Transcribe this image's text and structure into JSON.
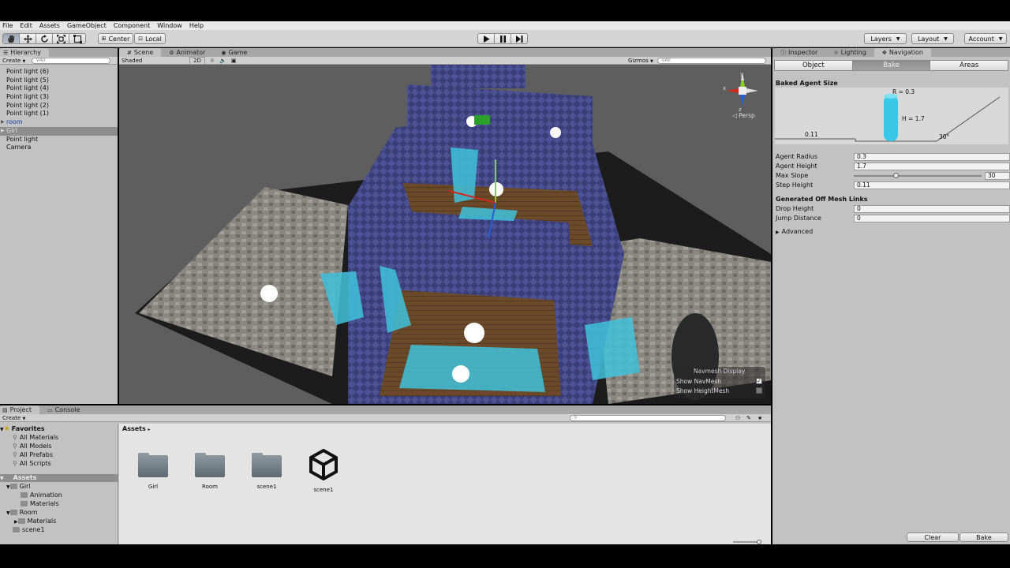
{
  "menubar": {
    "items": [
      "File",
      "Edit",
      "Assets",
      "GameObject",
      "Component",
      "Window",
      "Help"
    ]
  },
  "toolbar": {
    "tools": [
      "hand-icon",
      "move-icon",
      "rotate-icon",
      "scale-icon",
      "rect-icon"
    ],
    "pivot_label": "Center",
    "space_label": "Local",
    "layers_label": "Layers",
    "layout_label": "Layout",
    "account_label": "Account"
  },
  "hierarchy": {
    "tab_label": "Hierarchy",
    "create_label": "Create",
    "search_placeholder": "All",
    "items": [
      {
        "label": "Point light (6)"
      },
      {
        "label": "Point light (5)"
      },
      {
        "label": "Point light (4)"
      },
      {
        "label": "Point light (3)"
      },
      {
        "label": "Point light (2)"
      },
      {
        "label": "Point light (1)"
      },
      {
        "label": "room"
      },
      {
        "label": "Girl"
      },
      {
        "label": "Point light"
      },
      {
        "label": "Camera"
      }
    ]
  },
  "scene": {
    "tabs": [
      "Scene",
      "Animator",
      "Game"
    ],
    "shading_mode": "Shaded",
    "mode_2d_label": "2D",
    "gizmos_label": "Gizmos",
    "search_placeholder": "All",
    "persp_label": "Persp",
    "gizmo_axes": {
      "y": "y",
      "x": "x",
      "z": "z"
    },
    "navmesh_display": {
      "title": "Navmesh Display",
      "show_navmesh_label": "Show NavMesh",
      "show_navmesh_checked": true,
      "show_heightmesh_label": "Show HeightMesh",
      "show_heightmesh_checked": false
    }
  },
  "inspector": {
    "tabs": [
      "Inspector",
      "Lighting",
      "Navigation"
    ],
    "segments": [
      "Object",
      "Bake",
      "Areas"
    ],
    "active_segment": "Bake",
    "baked_agent_size_title": "Baked Agent Size",
    "diagram": {
      "radius_text": "R = 0.3",
      "height_text": "H = 1.7",
      "step_text": "0.11",
      "slope_text": "30°"
    },
    "agent_radius_label": "Agent Radius",
    "agent_radius": "0.3",
    "agent_height_label": "Agent Height",
    "agent_height": "1.7",
    "max_slope_label": "Max Slope",
    "max_slope": "30",
    "max_slope_fraction": 0.33,
    "step_height_label": "Step Height",
    "step_height": "0.11",
    "off_mesh_title": "Generated Off Mesh Links",
    "drop_height_label": "Drop Height",
    "drop_height": "0",
    "jump_distance_label": "Jump Distance",
    "jump_distance": "0",
    "advanced_label": "Advanced",
    "clear_label": "Clear",
    "bake_label": "Bake"
  },
  "project": {
    "tabs": [
      "Project",
      "Console"
    ],
    "create_label": "Create",
    "favorites_label": "Favorites",
    "favorites": [
      "All Materials",
      "All Models",
      "All Prefabs",
      "All Scripts"
    ],
    "assets_root": "Assets",
    "tree": {
      "girl": "Girl",
      "animation": "Animation",
      "girl_materials": "Materials",
      "room": "Room",
      "room_materials": "Materials",
      "scene1": "scene1"
    },
    "breadcrumb": "Assets",
    "assets": [
      {
        "name": "Girl",
        "type": "folder"
      },
      {
        "name": "Room",
        "type": "folder"
      },
      {
        "name": "scene1",
        "type": "folder"
      },
      {
        "name": "scene1",
        "type": "unity-scene"
      }
    ]
  },
  "colors": {
    "navmesh": "#3fc2da",
    "wall_pattern": "#3a3f7a",
    "floor": "#6b4a2a",
    "stone": "#8a8780",
    "selection": "#8e8e8e"
  }
}
